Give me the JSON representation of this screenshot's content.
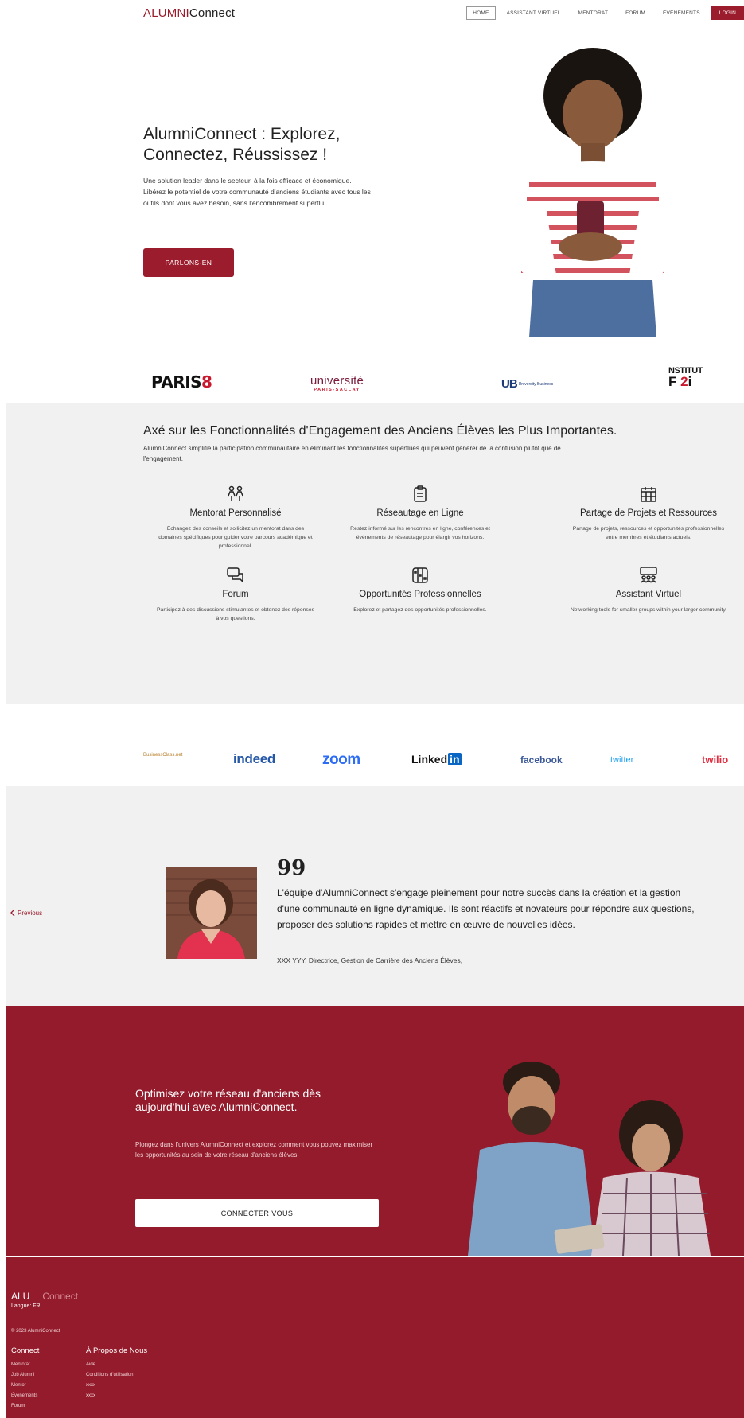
{
  "header": {
    "logo_part1": "ALUMNI",
    "logo_part2": "Connect",
    "nav": [
      "HOME",
      "ASSISTANT VIRTUEL",
      "MENTORAT",
      "FORUM",
      "ÉVÉNEMENTS",
      "LOGIN"
    ]
  },
  "hero": {
    "title": "AlumniConnect : Explorez, Connectez, Réussissez !",
    "text": "Une solution leader dans le secteur, à la fois efficace et économique. Libérez le potentiel de votre communauté d'anciens étudiants avec tous les outils dont vous avez besoin, sans l'encombrement superflu.",
    "button": "PARLONS-EN"
  },
  "partners": {
    "paris8_a": "PARIS",
    "paris8_b": "8",
    "saclay_a": "université",
    "saclay_b": "PARIS-SACLAY",
    "ub_a": "UB",
    "ub_b": "University Business",
    "f2i_a": "NSTITUT",
    "f2i_b": "F",
    "f2i_c": "2",
    "f2i_d": "i"
  },
  "features": {
    "title": "Axé sur les Fonctionnalités d'Engagement des Anciens Élèves les Plus Importantes.",
    "subtitle": "AlumniConnect simplifie la participation communautaire en éliminant les fonctionnalités superflues qui peuvent générer de la confusion plutôt que de l'engagement.",
    "items": [
      {
        "icon": "users-icon",
        "title": "Mentorat Personnalisé",
        "desc": "Échangez des conseils et sollicitez un mentorat dans des domaines spécifiques pour guider votre parcours académique et professionnel."
      },
      {
        "icon": "clipboard-icon",
        "title": "Réseautage en Ligne",
        "desc": "Restez informé sur les rencontres en ligne, conférences et événements de réseautage pour élargir vos horizons."
      },
      {
        "icon": "calendar-icon",
        "title": "Partage de Projets et Ressources",
        "desc": "Partage de projets, ressources et opportunités professionnelles entre membres et étudiants actuels."
      },
      {
        "icon": "chat-icon",
        "title": "Forum",
        "desc": "Participez à des discussions stimulantes et obtenez des réponses à vos questions."
      },
      {
        "icon": "briefcase-icon",
        "title": "Opportunités Professionnelles",
        "desc": "Explorez et partagez des opportunités professionnelles."
      },
      {
        "icon": "group-icon",
        "title": "Assistant Virtuel",
        "desc": "Networking tools for smaller groups within your larger community."
      }
    ]
  },
  "brands": {
    "bc": "BusinessClass.net",
    "indeed": "indeed",
    "zoom": "zoom",
    "linkedin_a": "Linked",
    "linkedin_b": "in",
    "facebook": "facebook",
    "twitter": "twitter",
    "twilio": "twilio"
  },
  "testimonial": {
    "prev": "Previous",
    "quote_mark": "99",
    "quote": "L'équipe d'AlumniConnect s'engage pleinement pour notre succès dans la création et la gestion d'une communauté en ligne dynamique. Ils sont réactifs et novateurs pour répondre aux questions, proposer des solutions rapides et mettre en œuvre de nouvelles idées.",
    "author": "XXX YYY, Directrice, Gestion de Carrière des Anciens Élèves,"
  },
  "cta": {
    "title": "Optimisez votre réseau d'anciens dès aujourd'hui avec AlumniConnect.",
    "text": "Plongez dans l'univers AlumniConnect et explorez comment vous pouvez maximiser les opportunités au sein de votre réseau d'anciens élèves.",
    "button": "CONNECTER VOUS"
  },
  "footer": {
    "logo_a": "ALU",
    "logo_b": "Connect",
    "lang": "Langue: FR",
    "copyright": "© 2023 AlumniConnect",
    "col1_title": "Connect",
    "col1_links": [
      "Mentorat",
      "Job Alumni",
      "Mentor",
      "Événements",
      "Forum"
    ],
    "col2_title": "À Propos de Nous",
    "col2_links": [
      "Aide",
      "Conditions d'utilisation",
      "xxxx",
      "xxxx"
    ]
  },
  "colors": {
    "brand": "#9b1c2c",
    "cta_bg": "#931b2b",
    "section_bg": "#f1f1f1"
  }
}
